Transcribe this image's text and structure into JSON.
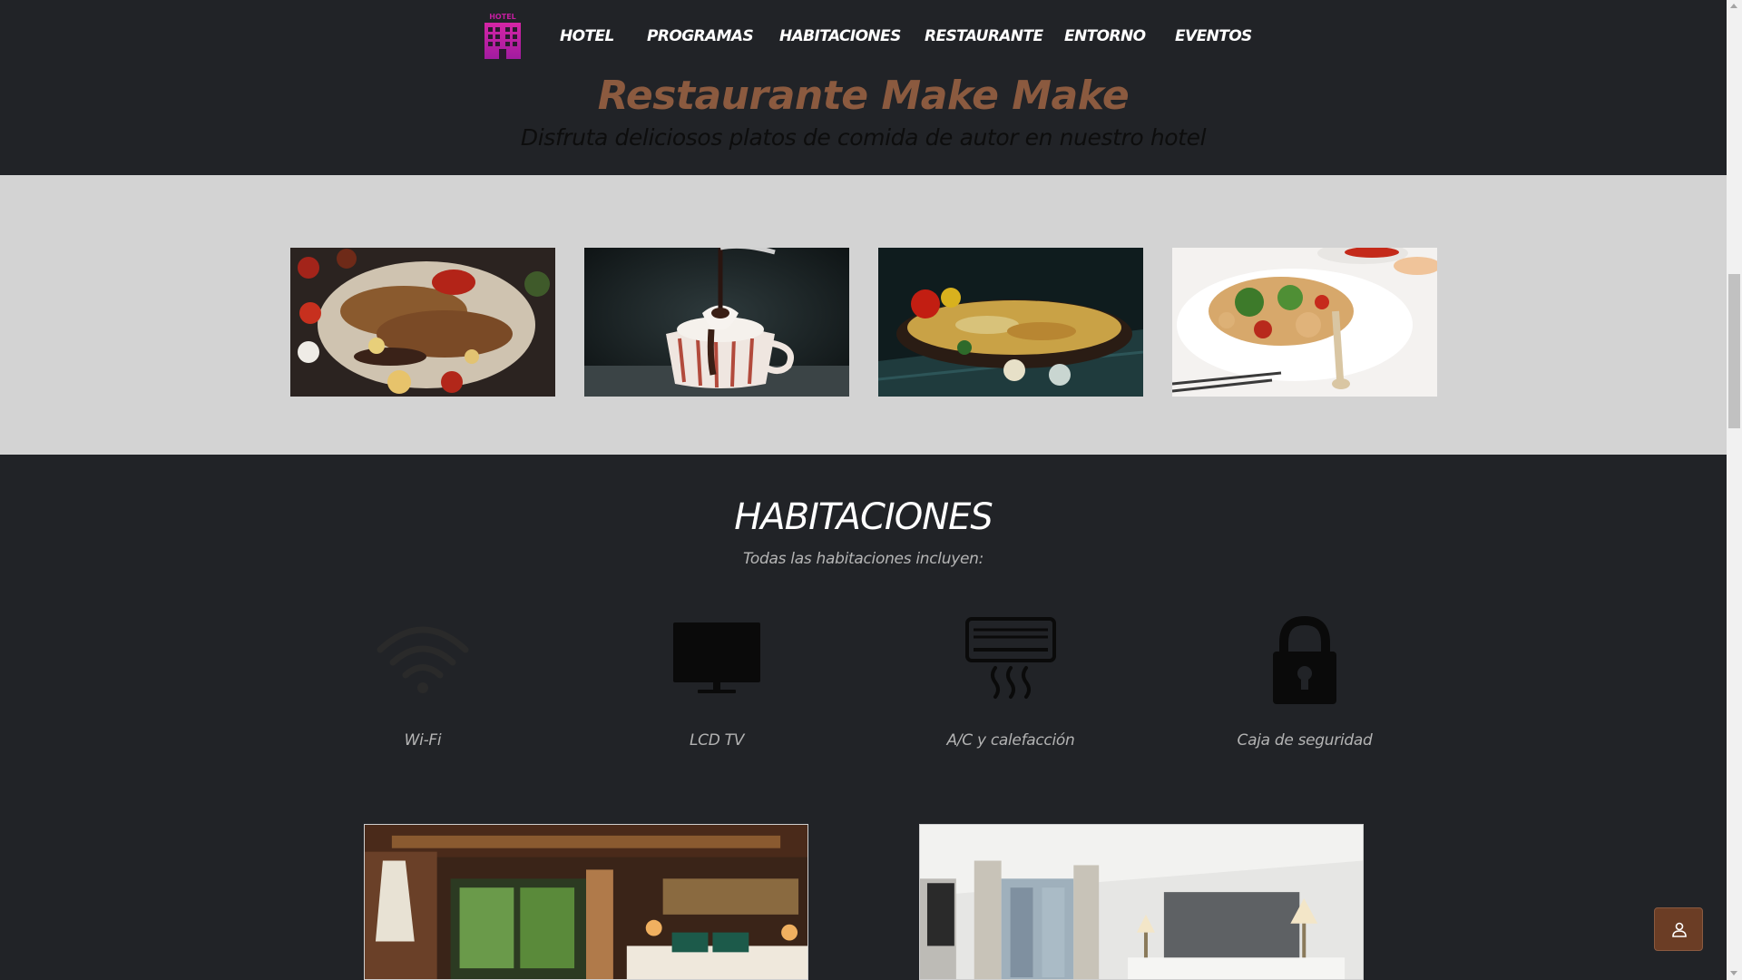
{
  "nav": {
    "logo_text": "HOTEL",
    "items": [
      "HOTEL",
      "PROGRAMAS",
      "HABITACIONES",
      "RESTAURANTE",
      "ENTORNO",
      "EVENTOS"
    ]
  },
  "restaurant": {
    "title": "Restaurante Make Make",
    "subtitle": "Disfruta deliciosos platos de comida de autor en nuestro hotel"
  },
  "rooms": {
    "title": "HABITACIONES",
    "subtitle": "Todas las habitaciones incluyen:",
    "amenities": [
      {
        "label": "Wi-Fi",
        "icon": "wifi-icon"
      },
      {
        "label": "LCD TV",
        "icon": "tv-icon"
      },
      {
        "label": "A/C y calefacción",
        "icon": "air-conditioner-icon"
      },
      {
        "label": "Caja de seguridad",
        "icon": "lock-icon"
      }
    ]
  },
  "colors": {
    "background": "#212327",
    "gallery_bg": "#d3d3d3",
    "title_accent": "#8b5a3f",
    "logo": "#c41ea0",
    "button": "#6b3d25"
  },
  "floating_button": {
    "icon": "user-icon"
  }
}
